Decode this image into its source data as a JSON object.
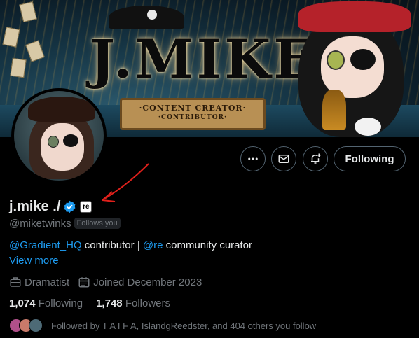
{
  "banner": {
    "title_art": "J.MIKE",
    "scroll_line1": "·CONTENT CREATOR·",
    "scroll_line2": "·CONTRIBUTOR·"
  },
  "actions": {
    "more_icon": "more-horizontal-icon",
    "message_icon": "envelope-icon",
    "notify_icon": "bell-plus-icon",
    "following_label": "Following"
  },
  "profile": {
    "display_name": "j.mike ./",
    "verified_icon": "verified-badge-icon",
    "affiliation_badge": "re",
    "handle": "@miketwinks",
    "follows_you": "Follows you",
    "bio": {
      "mention1": "@Gradient_HQ",
      "text1": " contributor | ",
      "mention2": "@re",
      "text2": " community curator"
    },
    "view_more": "View more",
    "category": "Dramatist",
    "joined": "Joined December 2023",
    "following_count": "1,074",
    "following_label": "Following",
    "followers_count": "1,748",
    "followers_label": "Followers",
    "followed_by": "Followed by T A I F A, IslandgReedster, and 404 others you follow"
  },
  "colors": {
    "accent": "#1d9bf0",
    "muted": "#71767b",
    "annotation": "#e0201b"
  }
}
